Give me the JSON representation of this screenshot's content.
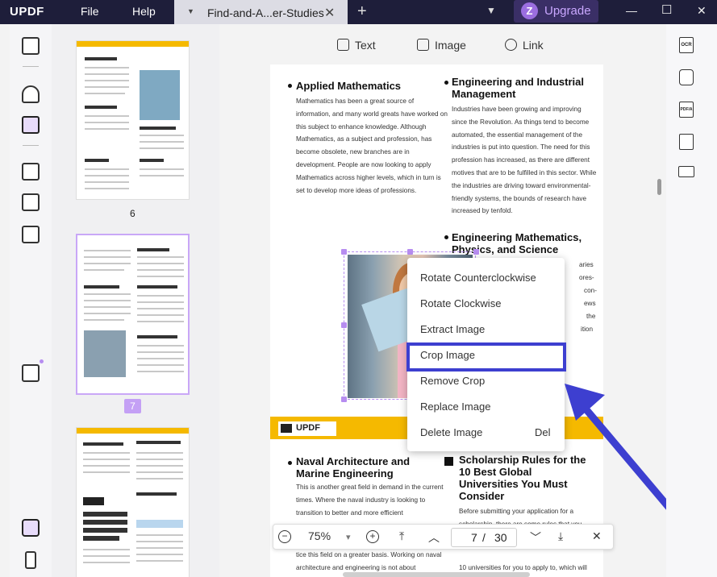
{
  "titlebar": {
    "logo": "UPDF",
    "menu_file": "File",
    "menu_help": "Help",
    "tab_name": "Find-and-A...er-Studies",
    "tab_close": "✕",
    "new_tab": "+",
    "dropdown_glyph": "⌄",
    "avatar_letter": "Z",
    "upgrade_label": "Upgrade",
    "minimize": "—",
    "maximize": "☐",
    "close": "✕"
  },
  "edit_toolbar": {
    "text_label": "Text",
    "image_label": "Image",
    "link_label": "Link"
  },
  "thumbnails": {
    "page_6": "6",
    "page_7": "7"
  },
  "page_content": {
    "applied_math_heading": "Applied Mathematics",
    "applied_math_body": "Mathematics has been a great source of information, and many world greats have worked on this subject to enhance knowledge. Although Mathematics, as a subject and profession, has become obsolete, new branches are in development. People are now looking to apply Mathematics across higher levels, which in turn is set to develop more ideas of professions.",
    "eng_ind_heading": "Engineering and Industrial Management",
    "eng_ind_body": "Industries have been growing and improving since the Revolution. As things tend to become automated, the essential management of the industries is put into question. The need for this profession has increased, as there are different motives that are to be fulfilled in this sector. While the industries are driving toward environmental-friendly systems, the bounds of research have increased by tenfold.",
    "eng_math_heading": "Engineering Mathematics, Physics, and Science",
    "eng_math_partial": [
      "aries",
      "ores-",
      "con-",
      "ews",
      "the",
      "ition"
    ],
    "banner_logo": "UPDF",
    "naval_heading": "Naval Architecture and Marine Engineering",
    "naval_body": "This is another great field in demand in the current times. Where the naval industry is looking to transition to better and more efficient",
    "naval_body2": "tice this field on a greater basis. Working on naval architecture and engineering is not about",
    "scholarship_heading": "Scholarship Rules for the 10 Best Global Universities You Must Consider",
    "scholarship_body": "Before submitting your application for a scholarship, there are some rules that you need to consider.",
    "scholarship_body2": "10 universities for you to apply to, which will"
  },
  "context_menu": {
    "items": [
      {
        "label": "Rotate Counterclockwise",
        "shortcut": ""
      },
      {
        "label": "Rotate Clockwise",
        "shortcut": ""
      },
      {
        "label": "Extract Image",
        "shortcut": ""
      },
      {
        "label": "Crop Image",
        "shortcut": ""
      },
      {
        "label": "Remove Crop",
        "shortcut": ""
      },
      {
        "label": "Replace Image",
        "shortcut": ""
      },
      {
        "label": "Delete Image",
        "shortcut": "Del"
      }
    ],
    "highlighted": "Crop Image"
  },
  "bottom_bar": {
    "zoom_out": "−",
    "zoom_value": "75%",
    "zoom_dropdown": "▾",
    "zoom_in": "+",
    "first_page": "⤒",
    "prev_page": "︿",
    "current_page": "7",
    "separator": "/",
    "total_pages": "30",
    "next_page": "﹀",
    "last_page": "⤓",
    "close": "✕"
  },
  "right_tools": {
    "ocr": "OCR",
    "pdfa": "PDF/A"
  },
  "colors": {
    "titlebar": "#1e1e3a",
    "accent": "#b68cf0",
    "highlight_box": "#3d3fd0",
    "brand_yellow": "#f5b900"
  },
  "icons": [
    "reader-icon",
    "comment-icon",
    "edit-pdf-icon",
    "organize-pages-icon",
    "crop-pages-icon",
    "tools-icon",
    "gift-icon",
    "layers-icon",
    "bookmark-icon",
    "ocr-icon",
    "convert-icon",
    "pdfa-icon",
    "protect-icon",
    "mail-icon"
  ]
}
